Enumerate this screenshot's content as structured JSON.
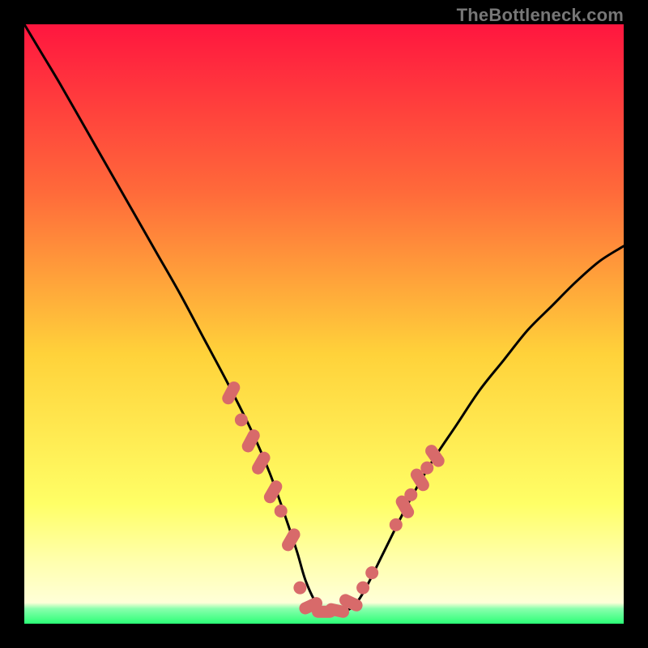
{
  "attribution": "TheBottleneck.com",
  "colors": {
    "gradient_top": "#ff163f",
    "gradient_mid_upper": "#ff6a3a",
    "gradient_mid": "#ffd23a",
    "gradient_lower": "#ffff66",
    "gradient_pale": "#ffffb0",
    "gradient_bottom": "#2bff76",
    "curve": "#000000",
    "marker": "#d86a6a",
    "frame": "#000000"
  },
  "chart_data": {
    "type": "line",
    "title": "",
    "xlabel": "",
    "ylabel": "",
    "xlim": [
      0,
      100
    ],
    "ylim": [
      0,
      100
    ],
    "grid": false,
    "legend": false,
    "series": [
      {
        "name": "bottleneck-curve",
        "x": [
          0,
          3,
          6,
          10,
          14,
          18,
          22,
          26,
          30,
          34,
          38,
          41,
          43.5,
          45.5,
          47,
          49,
          51,
          53,
          55,
          57,
          60,
          64,
          68,
          72,
          76,
          80,
          84,
          88,
          92,
          96,
          100
        ],
        "y": [
          100,
          95,
          90,
          83,
          76,
          69,
          62,
          55,
          47.5,
          40,
          32,
          25,
          18,
          12,
          7,
          3,
          2,
          2,
          3,
          6,
          12,
          20,
          27,
          33,
          39,
          44,
          49,
          53,
          57,
          60.5,
          63
        ]
      }
    ],
    "markers": [
      {
        "x": 34.5,
        "y": 38.5,
        "shape": "pill",
        "angle": -62
      },
      {
        "x": 36.2,
        "y": 34.0,
        "shape": "dot"
      },
      {
        "x": 37.8,
        "y": 30.5,
        "shape": "pill",
        "angle": -62
      },
      {
        "x": 39.5,
        "y": 26.8,
        "shape": "pill",
        "angle": -60
      },
      {
        "x": 41.5,
        "y": 22.0,
        "shape": "pill",
        "angle": -60
      },
      {
        "x": 42.8,
        "y": 18.8,
        "shape": "dot"
      },
      {
        "x": 44.5,
        "y": 14.0,
        "shape": "pill",
        "angle": -60
      },
      {
        "x": 46.0,
        "y": 6.0,
        "shape": "dot"
      },
      {
        "x": 47.8,
        "y": 3.0,
        "shape": "pill",
        "angle": -25
      },
      {
        "x": 50.0,
        "y": 2.0,
        "shape": "pill",
        "angle": 0
      },
      {
        "x": 52.2,
        "y": 2.2,
        "shape": "pill",
        "angle": 12
      },
      {
        "x": 54.5,
        "y": 3.5,
        "shape": "pill",
        "angle": 25
      },
      {
        "x": 56.5,
        "y": 6.0,
        "shape": "dot"
      },
      {
        "x": 58.0,
        "y": 8.5,
        "shape": "dot"
      },
      {
        "x": 62.0,
        "y": 16.5,
        "shape": "dot"
      },
      {
        "x": 63.5,
        "y": 19.5,
        "shape": "pill",
        "angle": 60
      },
      {
        "x": 64.5,
        "y": 21.5,
        "shape": "dot"
      },
      {
        "x": 66.0,
        "y": 24.0,
        "shape": "pill",
        "angle": 58
      },
      {
        "x": 67.2,
        "y": 26.0,
        "shape": "dot"
      },
      {
        "x": 68.5,
        "y": 28.0,
        "shape": "pill",
        "angle": 55
      }
    ],
    "gradient_stops": [
      {
        "offset": 0.0,
        "color": "#ff163f"
      },
      {
        "offset": 0.28,
        "color": "#ff6a3a"
      },
      {
        "offset": 0.55,
        "color": "#ffd23a"
      },
      {
        "offset": 0.8,
        "color": "#ffff66"
      },
      {
        "offset": 0.9,
        "color": "#ffffb0"
      },
      {
        "offset": 0.965,
        "color": "#ffffd8"
      },
      {
        "offset": 0.975,
        "color": "#89ffad"
      },
      {
        "offset": 1.0,
        "color": "#2bff76"
      }
    ]
  }
}
